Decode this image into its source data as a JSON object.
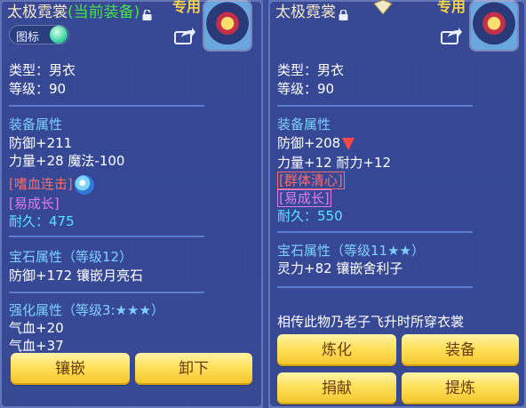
{
  "colors": {
    "title": "#f4e8c9",
    "current_equip": "#46e04b",
    "section": "#7fd0ff",
    "skill": "#ff6b6b",
    "growth": "#e07ce8",
    "durability": "#58e6ff",
    "button_text": "#6a3a12",
    "button_bg": "#ffe05a"
  },
  "left": {
    "title": "太极霓裳",
    "current_tag": "(当前装备)",
    "exclusive": "专用",
    "toggle_label": "图标",
    "type_line": "类型：男衣",
    "level_line": "等级：90",
    "equip_section": "装备属性",
    "attr1": "防御+211",
    "attr2": "力量+28 魔法-100",
    "skill": "[嗜血连击]",
    "growth": "[易成长]",
    "durability": "耐久：475",
    "gem_section": "宝石属性（等级12）",
    "gem_line": "防御+172 镶嵌月亮石",
    "enhance_section": "强化属性（等级3:★★★）",
    "enhance1": "气血+20",
    "enhance2": "气血+37",
    "buttons": [
      "镶嵌",
      "卸下"
    ]
  },
  "right": {
    "title": "太极霓裳",
    "exclusive": "专用",
    "type_line": "类型：男衣",
    "level_line": "等级：90",
    "equip_section": "装备属性",
    "attr1": "防御+208",
    "attr2": "力量+12 耐力+12",
    "skill": "[群体清心]",
    "growth": "[易成长]",
    "durability": "耐久：550",
    "gem_section": "宝石属性（等级11★★）",
    "gem_line": "灵力+82 镶嵌舍利子",
    "description": "相传此物乃老子飞升时所穿衣裳",
    "buttons": [
      "炼化",
      "装备",
      "捐献",
      "提炼"
    ]
  },
  "icons": [
    "lock-open-icon",
    "lock-closed-icon",
    "share-icon",
    "gem-icon",
    "down-arrow-icon",
    "badge-icon"
  ]
}
